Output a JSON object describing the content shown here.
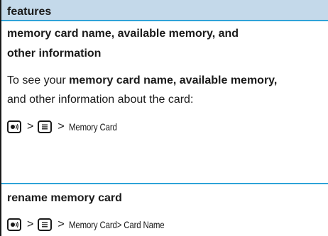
{
  "header": {
    "title": "features"
  },
  "section1": {
    "title": "memory card name, available memory, and other information",
    "body_prefix": "To see your ",
    "body_bold": "memory card name, available memory,",
    "body_suffix": " and other information about the card:",
    "path": {
      "sep": ">",
      "label": "Memory Card"
    }
  },
  "section2": {
    "title": "rename memory card",
    "path": {
      "sep": ">",
      "label": "Memory Card> Card Name"
    }
  },
  "icons": {
    "center_key": "center-select-key-icon",
    "menu_key": "menu-key-icon"
  },
  "colors": {
    "header_bg": "#c4d9ea",
    "divider": "#2ea3d8"
  }
}
